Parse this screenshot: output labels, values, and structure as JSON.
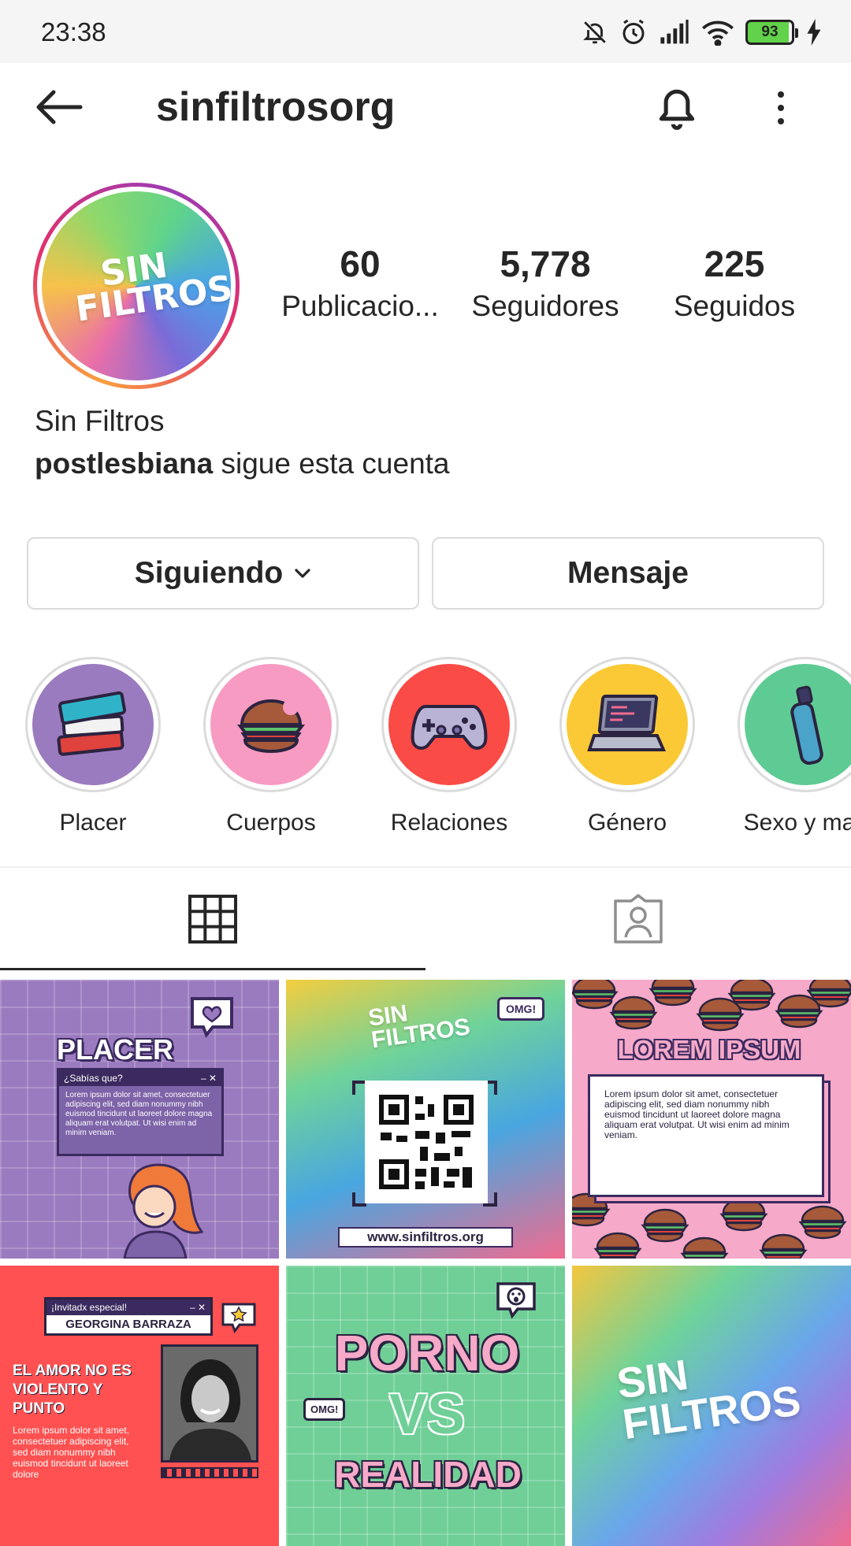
{
  "status_bar": {
    "time": "23:38",
    "battery": "93",
    "icons": [
      "bell-off-icon",
      "alarm-icon",
      "signal-icon",
      "wifi-icon",
      "battery-icon",
      "charging-icon"
    ]
  },
  "header": {
    "username": "sinfiltrosorg"
  },
  "profile": {
    "avatar_text": "SIN FILTROS",
    "stats": [
      {
        "value": "60",
        "label": "Publicacio..."
      },
      {
        "value": "5,778",
        "label": "Seguidores"
      },
      {
        "value": "225",
        "label": "Seguidos"
      }
    ],
    "display_name": "Sin Filtros",
    "followed_by_user": "postlesbiana",
    "followed_by_text": " sigue esta cuenta"
  },
  "actions": {
    "following_label": "Siguiendo",
    "message_label": "Mensaje"
  },
  "highlights": [
    {
      "label": "Placer",
      "color": "#9b7bbf"
    },
    {
      "label": "Cuerpos",
      "color": "#f79bc3"
    },
    {
      "label": "Relaciones",
      "color": "#fa4b46"
    },
    {
      "label": "Género",
      "color": "#fbc936"
    },
    {
      "label": "Sexo y mas",
      "color": "#5fcb94"
    }
  ],
  "posts": {
    "p1": {
      "title": "PLACER",
      "window_title": "¿Sabías que?",
      "body": "Lorem ipsum dolor sit amet, consectetuer adipiscing elit, sed diam nonummy nibh euismod tincidunt ut laoreet dolore magna aliquam erat volutpat. Ut wisi enim ad minim veniam."
    },
    "p2": {
      "logo": "SIN FILTROS",
      "bubble": "OMG!",
      "url": "www.sinfiltros.org"
    },
    "p3": {
      "title": "LOREM IPSUM",
      "body": "Lorem ipsum dolor sit amet, consectetuer adipiscing elit, sed diam nonummy nibh euismod tincidunt ut laoreet dolore magna aliquam erat volutpat. Ut wisi enim ad minim veniam."
    },
    "p4": {
      "window_title": "¡Invitadx especial!",
      "guest": "GEORGINA BARRAZA",
      "headline": "EL AMOR NO ES VIOLENTO Y PUNTO",
      "body": "Lorem ipsum dolor sit amet, consectetuer adipiscing elit, sed diam nonummy nibh euismod tincidunt ut laoreet dolore"
    },
    "p5": {
      "line1": "PORNO",
      "line2": "VS",
      "line3": "REALIDAD",
      "bubble": "OMG!"
    },
    "p6": {
      "logo": "SIN FILTROS"
    }
  }
}
